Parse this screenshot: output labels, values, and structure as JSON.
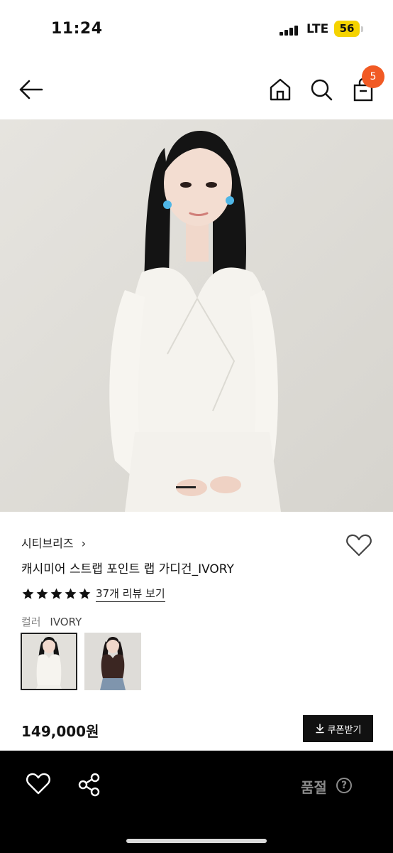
{
  "status_bar": {
    "time": "11:24",
    "network": "LTE",
    "battery": "56"
  },
  "header": {
    "cart_count": "5"
  },
  "product": {
    "brand": "시티브리즈",
    "brand_chevron": "›",
    "name": "캐시미어 스트랩 포인트 랩 가디건_IVORY",
    "rating_stars": 5,
    "review_link": "37개 리뷰 보기",
    "option_label": "컬러",
    "option_value": "IVORY",
    "swatches": [
      {
        "label": "IVORY",
        "selected": true
      },
      {
        "label": "BROWN",
        "selected": false
      }
    ],
    "image_count_current": 1,
    "price": "149,000원"
  },
  "coupon_button": {
    "label": "쿠폰받기",
    "icon": "download-icon"
  },
  "bottom_bar": {
    "status": "품절",
    "help": "?"
  },
  "colors": {
    "accent": "#f15a24",
    "dark": "#111111",
    "muted": "#8a8a8a"
  }
}
